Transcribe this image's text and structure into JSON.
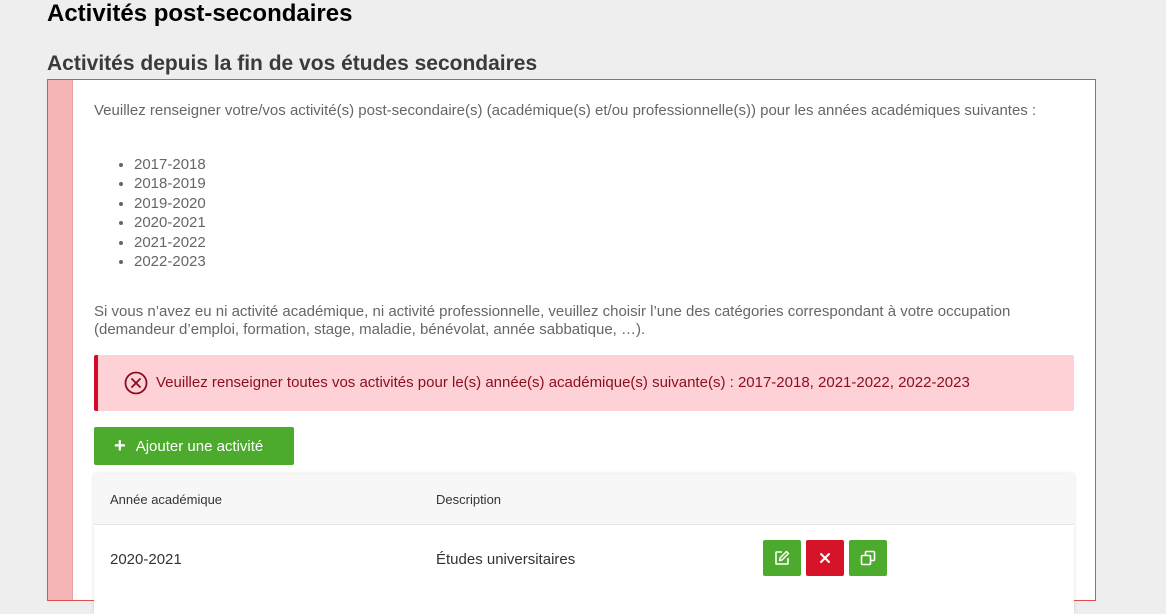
{
  "page": {
    "title": "Activités post-secondaires",
    "section_title": "Activités depuis la fin de vos études secondaires"
  },
  "panel": {
    "intro": "Veuillez renseigner votre/vos activité(s) post-secondaire(s) (académique(s) et/ou professionnelle(s)) pour les années académiques suivantes :",
    "years": [
      "2017-2018",
      "2018-2019",
      "2019-2020",
      "2020-2021",
      "2021-2022",
      "2022-2023"
    ],
    "note": "Si vous n’avez eu ni activité académique, ni activité professionnelle, veuillez choisir l’une des catégories correspondant à votre occupation (demandeur d’emploi, formation, stage, maladie, bénévolat, année sabbatique, …).",
    "alert": {
      "icon": "error-circle-icon",
      "text": "Veuillez renseigner toutes vos activités pour le(s) année(s) académique(s) suivante(s) : 2017-2018, 2021-2022, 2022-2023"
    },
    "add_button": {
      "icon": "plus-icon",
      "label": "Ajouter une activité"
    }
  },
  "table": {
    "columns": [
      "Année académique",
      "Description"
    ],
    "rows": [
      {
        "year": "2020-2021",
        "description": "Études universitaires",
        "actions": [
          "edit-icon",
          "delete-icon",
          "duplicate-icon"
        ]
      }
    ]
  },
  "colors": {
    "accent_green": "#4caa2d",
    "danger_red": "#d7132a",
    "alert_bg": "#fdd1d6",
    "alert_text": "#8b0e1f",
    "panel_border": "#e05050",
    "sidebar_pink": "#f5b5b7"
  }
}
